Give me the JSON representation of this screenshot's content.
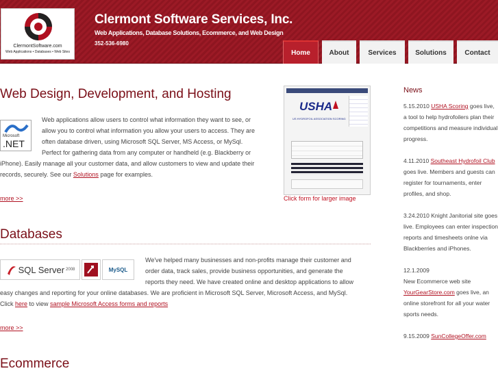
{
  "header": {
    "logo_domain": "ClermontSoftware.com",
    "logo_sub": "Web Applications • Databases • Web Sites",
    "title": "Clermont Software Services, Inc.",
    "tagline": "Web Applications, Database Solutions, Ecommerce, and Web Design",
    "phone": "352-536-6980",
    "brand_color": "#9c1a26"
  },
  "nav": [
    {
      "label": "Home",
      "active": true
    },
    {
      "label": "About",
      "active": false
    },
    {
      "label": "Services",
      "active": false
    },
    {
      "label": "Solutions",
      "active": false
    },
    {
      "label": "Contact",
      "active": false
    }
  ],
  "sections": {
    "web": {
      "title": "Web Design, Development, and Hosting",
      "body_1": "Web applications allow users to control what information they want to see, or",
      "body_2": "allow you to control what information you allow your users to access. They are",
      "body_3": "often database driven, using Microsoft SQL Server, MS Access, or MySql.",
      "body_4": "Perfect for gathering data from any computer or handheld (e.g. Blackberry or",
      "body_5": "iPhone). Easily manage all your customer data, and allow customers to view and update their",
      "body_6_pre": "records, securely. See our ",
      "body_6_link": "Solutions",
      "body_6_post": " page for examples.",
      "more": "more >>",
      "logo_brand": "Microsoft",
      "logo_text": ".NET"
    },
    "thumb": {
      "caption": "Click form for larger image",
      "brand": "USHA",
      "heading": "US HYDROFOIL ASSOCIATION SCORING"
    },
    "db": {
      "title": "Databases",
      "body_1": "We've helped many businesses and non-profits manage their customer and",
      "body_2": "order data, track sales, provide business opportunities, and generate the",
      "body_3": "reports they need. We have created online and desktop applications to allow",
      "body_4": "easy changes and reporting for your online databases. We are proficient in Microsoft SQL Server, Microsoft Access, and MySql.",
      "body_5_pre": "Click ",
      "body_5_link1": "here",
      "body_5_mid": " to view ",
      "body_5_link2": "sample Microsoft Access forms and reports",
      "more": "more >>",
      "logo_sql": "SQL Server",
      "logo_sql_ver": "2008",
      "logo_mysql": "MySQL"
    },
    "ecom": {
      "title": "Ecommerce"
    }
  },
  "news": {
    "title": "News",
    "items": [
      {
        "date": "5.15.2010",
        "link": "USHA Scoring",
        "text": " goes live, a tool to help hydrofoilers plan their competitions and measure individual progress."
      },
      {
        "date": "4.11.2010",
        "link": "Southeast Hydrofoil Club",
        "text": " goes live. Members and guests can register for tournaments, enter profiles, and shop."
      },
      {
        "date": "3.24.2010",
        "link": "",
        "text": "Knight Janitorial site goes live. Employees can enter inspection reports and timesheets onlne via Blackberries and iPhones."
      },
      {
        "date": "12.1.2009",
        "pre": "New Ecommerce web site ",
        "link": "YourGearStore.com",
        "text": " goes live, an online storefront for all your water sports needs."
      },
      {
        "date": "9.15.2009",
        "link": "SunCollegeOffer.com",
        "text": ""
      }
    ]
  }
}
